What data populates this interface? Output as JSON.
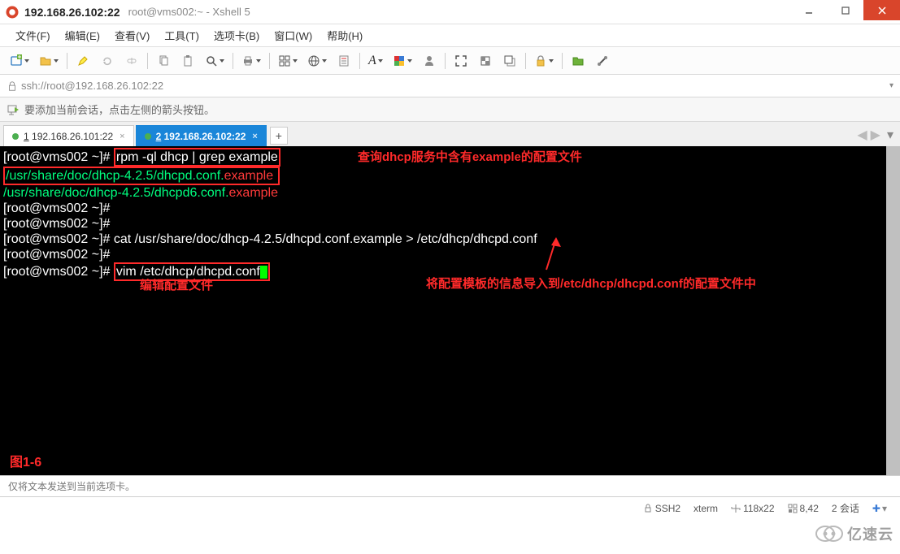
{
  "title": {
    "main": "192.168.26.102:22",
    "sub": "root@vms002:~ - Xshell 5"
  },
  "menu": {
    "file": "文件(F)",
    "edit": "编辑(E)",
    "view": "查看(V)",
    "tools": "工具(T)",
    "tab": "选项卡(B)",
    "window": "窗口(W)",
    "help": "帮助(H)"
  },
  "address": "ssh://root@192.168.26.102:22",
  "info_text": "要添加当前会话，点击左侧的箭头按钮。",
  "tabs": {
    "t1_num": "1",
    "t1_ip": "192.168.26.101:22",
    "t2_num": "2",
    "t2_ip": "192.168.26.102:22",
    "add": "+"
  },
  "term": {
    "prompt": "[root@vms002 ~]#",
    "cmd1": "rpm -ql dhcp | grep example",
    "out1a_pre": "/usr/share/doc/dhcp-4.2.5/dhcpd.conf.",
    "out1a_suf": "example",
    "out1b_pre": "/usr/share/doc/dhcp-4.2.5/dhcpd6.conf.",
    "out1b_suf": "example",
    "cmd2": "cat /usr/share/doc/dhcp-4.2.5/dhcpd.conf.example > /etc/dhcp/dhcpd.conf",
    "cmd3": "vim /etc/dhcp/dhcpd.conf",
    "ann1": "查询dhcp服务中含有example的配置文件",
    "ann2": "将配置模板的信息导入到/etc/dhcp/dhcpd.conf的配置文件中",
    "ann3": "编辑配置文件",
    "fig": "图1-6"
  },
  "bottom_placeholder": "仅将文本发送到当前选项卡。",
  "status": {
    "ssh": "SSH2",
    "xterm": "xterm",
    "size": "118x22",
    "pos": "8,42",
    "sess": "2 会话"
  },
  "brand": "亿速云"
}
